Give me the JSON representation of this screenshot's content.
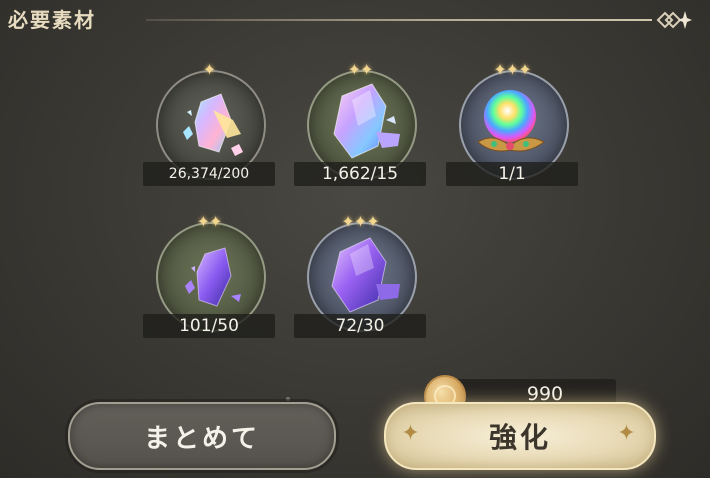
{
  "header": {
    "title": "必要素材"
  },
  "materials": [
    {
      "stars": "✦",
      "count": "26,374/200"
    },
    {
      "stars": "✦✦",
      "count": "1,662/15"
    },
    {
      "stars": "✦✦✦",
      "count": "1/1"
    },
    {
      "stars": "✦✦",
      "count": "101/50"
    },
    {
      "stars": "✦✦✦",
      "count": "72/30"
    }
  ],
  "cost": {
    "icon": "coin-icon",
    "value": "990"
  },
  "buttons": {
    "bulk_label": "まとめて",
    "enhance_label": "強化"
  },
  "colors": {
    "gold": "#f2d690",
    "button_light": "#e7d9b4",
    "button_dark": "#55524c"
  }
}
